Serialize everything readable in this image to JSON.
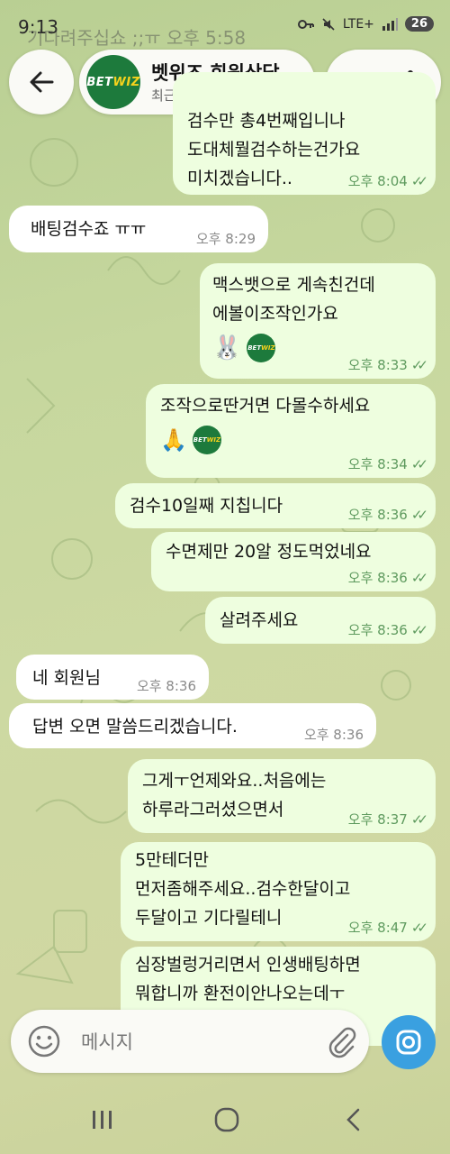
{
  "status_bar": {
    "time": "9:13",
    "network": "LTE+",
    "battery": "26"
  },
  "header": {
    "avatar_text_a": "BET",
    "avatar_text_b": "WIZ",
    "name": "벳위즈 회원상담",
    "status": "최근에 접속함"
  },
  "background_fragment": "기다려주십쇼 ;;ㅠ  오후 5:58",
  "messages": [
    {
      "dir": "out",
      "text": "검수만 총4번째입니나\n도대체뭘검수하는건가요\n미치겠습니다..",
      "time": "오후 8:04",
      "read": true
    },
    {
      "dir": "in",
      "text": "배팅검수죠 ㅠㅠ",
      "time": "오후 8:29"
    },
    {
      "dir": "out",
      "text": "맥스뱃으로 게속친건데\n에볼이조작인가요",
      "time": "오후 8:33",
      "read": true,
      "stickers": [
        "rabbit-emoji",
        "betwiz-logo"
      ]
    },
    {
      "dir": "out",
      "text": "조작으로딴거면 다몰수하세요",
      "time": "오후 8:34",
      "read": true,
      "stickers": [
        "pray-emoji",
        "betwiz-logo"
      ]
    },
    {
      "dir": "out",
      "text": "검수10일째 지칩니다",
      "time": "오후 8:36",
      "read": true
    },
    {
      "dir": "out",
      "text": "수면제만 20알 정도먹었네요",
      "time": "오후 8:36",
      "read": true
    },
    {
      "dir": "out",
      "text": "살려주세요",
      "time": "오후 8:36",
      "read": true
    },
    {
      "dir": "in",
      "text": "네 회원님",
      "time": "오후 8:36"
    },
    {
      "dir": "in",
      "text": "답변 오면 말씀드리겠습니다.",
      "time": "오후 8:36"
    },
    {
      "dir": "out",
      "text": "그게ㅜ언제와요..처음에는\n하루라그러셨으면서",
      "time": "오후 8:37",
      "read": true
    },
    {
      "dir": "out",
      "text": "5만테더만\n먼저좀해주세요..검수한달이고\n두달이고 기다릴테니",
      "time": "오후 8:47",
      "read": true
    },
    {
      "dir": "out",
      "text": "심장벌렁거리면서 인생배팅하면\n뭐합니까 환전이안나오는데ㅜ",
      "time": "",
      "read": false
    }
  ],
  "composer": {
    "placeholder": "메시지"
  },
  "colors": {
    "outgoing_bubble": "#eefedf",
    "incoming_bubble": "#ffffff",
    "accent": "#3aa0e0",
    "brand_green": "#1d7a3c"
  }
}
